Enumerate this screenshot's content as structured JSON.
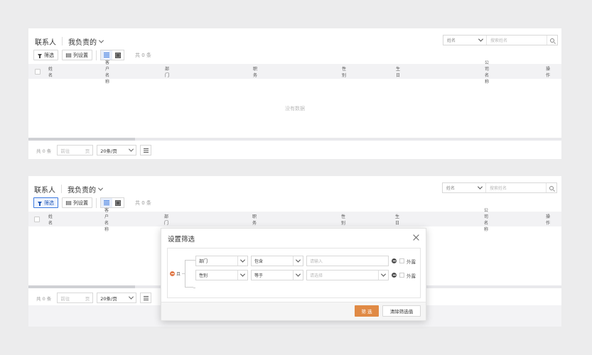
{
  "top": {
    "title": "联系人",
    "view": "我负责的",
    "toolbar": {
      "filter_label": "筛选",
      "columns_label": "列设置",
      "count": "共 0 条"
    },
    "search": {
      "field": "姓名",
      "placeholder": "搜索姓名"
    },
    "columns": [
      "姓名",
      "客户名称",
      "部门",
      "职务",
      "性别",
      "生日",
      "公司名称",
      "操作"
    ],
    "empty": "没有数据",
    "pager": {
      "total": "共 0 条",
      "goto_prefix": "前往",
      "goto_suffix": "页",
      "page_size": "20条/页"
    }
  },
  "bottom": {
    "title": "联系人",
    "view": "我负责的",
    "toolbar": {
      "filter_label": "筛选",
      "columns_label": "列设置",
      "count": "共 0 条"
    },
    "search": {
      "field": "姓名",
      "placeholder": "搜索姓名"
    },
    "columns": [
      "姓名",
      "客户名称",
      "部门",
      "职务",
      "性别",
      "生日",
      "公司名称",
      "操作"
    ],
    "pager": {
      "total": "共 0 条",
      "goto_prefix": "前往",
      "goto_suffix": "页",
      "page_size": "20条/页"
    }
  },
  "dialog": {
    "title": "设置筛选",
    "logic": "且",
    "conditions": [
      {
        "field": "部门",
        "operator": "包含",
        "value_placeholder": "请输入",
        "expose": "外露"
      },
      {
        "field": "性别",
        "operator": "等于",
        "value_placeholder": "请选择",
        "expose": "外露"
      }
    ],
    "confirm": "筛 选",
    "clear": "清除筛选值"
  },
  "colors": {
    "accent": "#e08a45",
    "active_blue": "#3d7be0",
    "header_bg": "#f2f2f4"
  }
}
